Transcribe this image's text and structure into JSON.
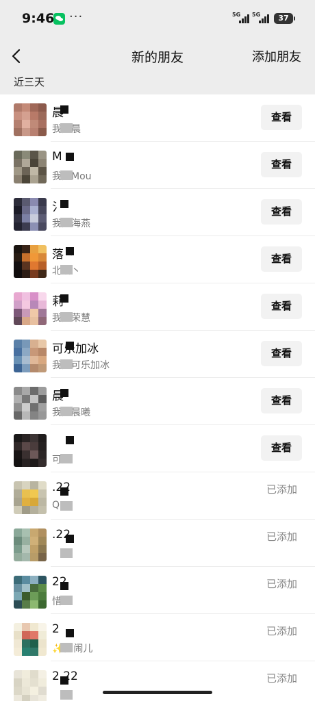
{
  "status_bar": {
    "time": "9:46",
    "dots": "···",
    "signal1_label": "5G",
    "signal2_label": "5G",
    "battery": "37"
  },
  "nav": {
    "title": "新的朋友",
    "action": "添加朋友",
    "back_icon": "chevron-left-icon"
  },
  "section_label": "近三天",
  "friends": [
    {
      "name": "晨",
      "message": "我是晨",
      "action": "查看",
      "added": false,
      "avatar_colors": [
        "#b07a6a",
        "#c48a78",
        "#a06858",
        "#8c5a4c",
        "#c89080",
        "#d4a090",
        "#b87a68",
        "#9c6a5a",
        "#b48070",
        "#e0b0a0",
        "#c08a78",
        "#a87060",
        "#a07060",
        "#c89888",
        "#b88070",
        "#8a5a4a"
      ]
    },
    {
      "name": "M",
      "message": "我是Mou",
      "action": "查看",
      "added": false,
      "avatar_colors": [
        "#6a6a5a",
        "#8a8a78",
        "#5a5448",
        "#9a9484",
        "#7a7264",
        "#b0a898",
        "#4a4438",
        "#8c8474",
        "#a09886",
        "#6c6456",
        "#c0b8a6",
        "#5c5446",
        "#8a8070",
        "#4c4638",
        "#aaa290",
        "#706858"
      ]
    },
    {
      "name": "氵",
      "message": "我是海燕",
      "action": "查看",
      "added": false,
      "avatar_colors": [
        "#2c2c3a",
        "#5a5a70",
        "#8a8ab0",
        "#3a3a4c",
        "#1c1c28",
        "#6a6a88",
        "#aab0d0",
        "#48485c",
        "#303040",
        "#7c80a4",
        "#c8ccdc",
        "#5c5c74",
        "#222230",
        "#3c3c50",
        "#8c90b4",
        "#4a4a60"
      ]
    },
    {
      "name": "落丶",
      "message": "北落丶",
      "action": "查看",
      "added": false,
      "avatar_colors": [
        "#1a1410",
        "#3a2418",
        "#e8a040",
        "#f0c060",
        "#281c14",
        "#c8702c",
        "#f09838",
        "#d88838",
        "#141010",
        "#5a3420",
        "#e07830",
        "#b86028",
        "#100c0c",
        "#2c1c14",
        "#783c20",
        "#402818"
      ]
    },
    {
      "name": "莉",
      "message": "我是荣慧",
      "action": "查看",
      "added": false,
      "avatar_colors": [
        "#e8a8d0",
        "#f0c0e0",
        "#d890c8",
        "#f8d8ec",
        "#d0a0c8",
        "#f4c8e0",
        "#b888b8",
        "#e8b8d8",
        "#7c5878",
        "#c89ab8",
        "#f0c8a8",
        "#a07898",
        "#604858",
        "#d8a888",
        "#e8c0a0",
        "#906878"
      ]
    },
    {
      "name": "可乐加冰",
      "message": "我是可乐加冰",
      "action": "查看",
      "added": false,
      "avatar_colors": [
        "#5a80a8",
        "#7898b8",
        "#d8b090",
        "#e8c8a8",
        "#4870a0",
        "#8ca8c4",
        "#c89878",
        "#b88868",
        "#6890b4",
        "#a8bcd0",
        "#e0b898",
        "#d8a880",
        "#3c6494",
        "#7c9cbc",
        "#b48a6c",
        "#c09a78"
      ]
    },
    {
      "name": "晨",
      "message": "我是晨曦",
      "action": "查看",
      "added": false,
      "avatar_colors": [
        "#8a8a8a",
        "#a8a8a8",
        "#6c6c6c",
        "#9c9c9c",
        "#b0b0b0",
        "#787878",
        "#c4c4c4",
        "#5c5c5c",
        "#909090",
        "#cccccc",
        "#707070",
        "#a0a0a0",
        "#686868",
        "#b8b8b8",
        "#848484",
        "#989898"
      ]
    },
    {
      "name": "",
      "message": "可爽",
      "action": "查看",
      "added": false,
      "avatar_colors": [
        "#1a1818",
        "#2a2424",
        "#3c3434",
        "#201c1c",
        "#302828",
        "#5a4848",
        "#4a3c3c",
        "#242020",
        "#181414",
        "#3a3030",
        "#6c5858",
        "#2c2626",
        "#141212",
        "#282222",
        "#1e1a1a",
        "#342c2c"
      ]
    },
    {
      "name": ".22",
      "message": "Q",
      "action": "已添加",
      "added": true,
      "avatar_colors": [
        "#c8c4b0",
        "#d8d4c0",
        "#b8b4a0",
        "#e0dcc8",
        "#b0ac98",
        "#e8c050",
        "#f0c850",
        "#c8c4b0",
        "#a8a490",
        "#e0b040",
        "#d8a838",
        "#bcb8a4",
        "#d0ccb8",
        "#a09c88",
        "#b4b09c",
        "#c4c0ac"
      ]
    },
    {
      "name": ".22",
      "message": "",
      "action": "已添加",
      "added": true,
      "avatar_colors": [
        "#8aa898",
        "#a8c0b0",
        "#c8a870",
        "#b09060",
        "#6c8c7c",
        "#98b0a0",
        "#d0b078",
        "#a08858",
        "#7c9c8c",
        "#b8c8bc",
        "#c0a068",
        "#8c7850",
        "#94ac9c",
        "#a4b8ac",
        "#b89c68",
        "#786448"
      ]
    },
    {
      "name": "22",
      "message": "惜",
      "action": "已添加",
      "added": true,
      "avatar_colors": [
        "#3c6c78",
        "#5a8ca0",
        "#8cb0c0",
        "#2c5460",
        "#6890a0",
        "#a0c0c8",
        "#486c3c",
        "#5c8c48",
        "#7ca8b4",
        "#3c5c2c",
        "#6c9c58",
        "#4c7c3c",
        "#2c4c54",
        "#587c48",
        "#8cb870",
        "#3c6830"
      ]
    },
    {
      "name": "2",
      "message": "✨闹闹儿",
      "action": "已添加",
      "added": true,
      "avatar_colors": [
        "#f4f0e0",
        "#e8c8b0",
        "#f0e8d0",
        "#f8f4e8",
        "#e8e0c8",
        "#d06858",
        "#e07868",
        "#f0ecd8",
        "#f0e8d4",
        "#2c7060",
        "#20604c",
        "#ece4cc",
        "#f4ecd8",
        "#288070",
        "#307868",
        "#f0e8d0"
      ]
    },
    {
      "name": "2.22",
      "message": "",
      "action": "已添加",
      "added": true,
      "avatar_colors": [
        "#e8e4d8",
        "#f0ecdc",
        "#e0dccc",
        "#f4f0e4",
        "#d8d4c4",
        "#ece8d8",
        "#e4e0d0",
        "#f0ecdc",
        "#dcd8c8",
        "#e8e4d4",
        "#f4f0e0",
        "#e0dcd0",
        "#ece8dc",
        "#d4d0c0",
        "#e8e4d8",
        "#f0ece0"
      ]
    }
  ]
}
